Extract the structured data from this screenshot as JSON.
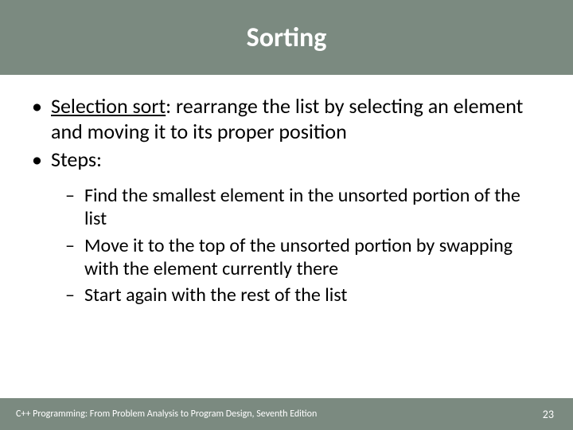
{
  "title": "Sorting",
  "bullets": [
    {
      "term": "Selection sort",
      "rest": ": rearrange the list by selecting an element and moving it to its proper position"
    },
    {
      "text": "Steps:"
    }
  ],
  "steps": [
    "Find the smallest element in the unsorted portion of the list",
    "Move it to the top of the unsorted portion by swapping with the element currently there",
    "Start again with the rest of the list"
  ],
  "footer": "C++ Programming: From Problem Analysis to Program Design, Seventh Edition",
  "page": "23"
}
